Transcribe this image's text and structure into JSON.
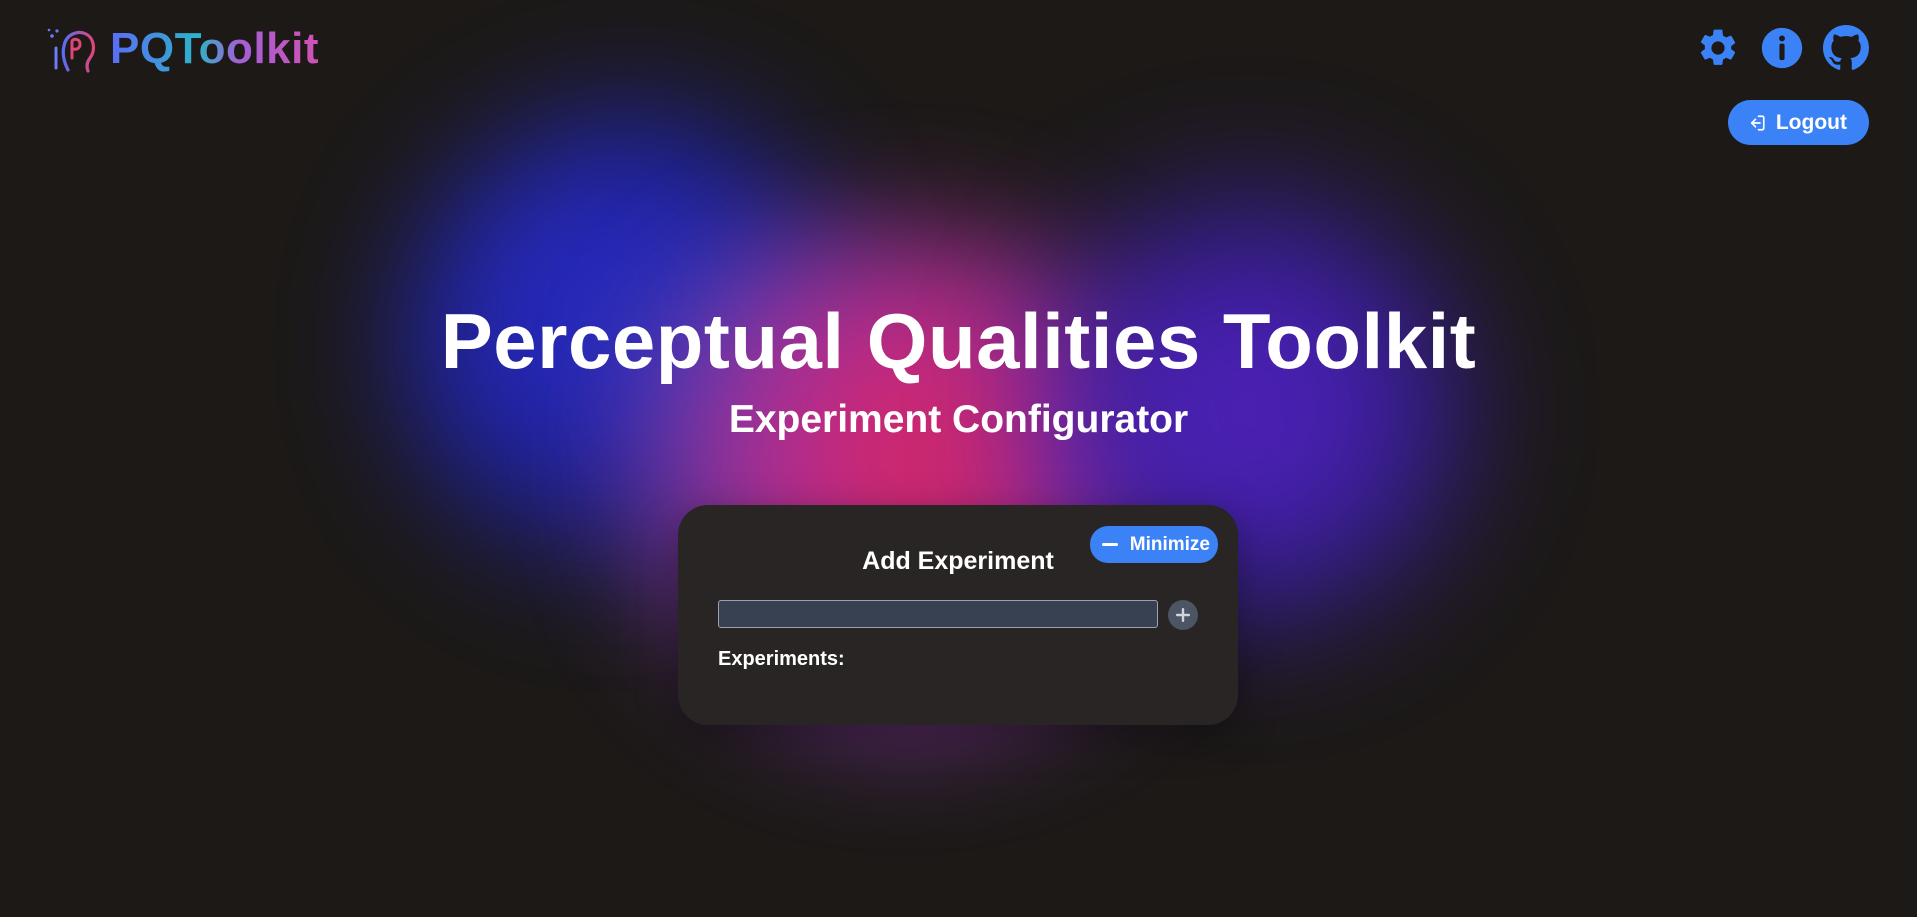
{
  "brand": {
    "name": "PQToolkit"
  },
  "header": {
    "icons": [
      "gear-icon",
      "info-icon",
      "github-icon"
    ],
    "logout_label": "Logout",
    "accent_color": "#3b82f6"
  },
  "hero": {
    "title": "Perceptual Qualities Toolkit",
    "subtitle": "Experiment Configurator"
  },
  "card": {
    "minimize_label": "Minimize",
    "title": "Add Experiment",
    "input_value": "",
    "input_placeholder": "",
    "experiments_label": "Experiments:",
    "experiments": []
  }
}
